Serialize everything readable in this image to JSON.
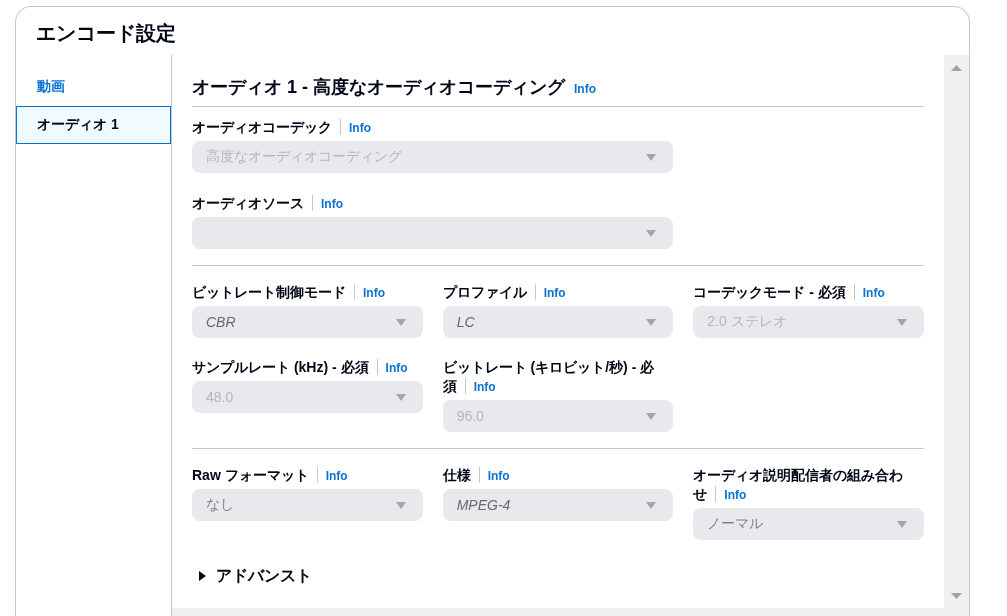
{
  "window": {
    "title": "エンコード設定"
  },
  "sidebar": {
    "items": [
      {
        "label": "動画",
        "selected": false
      },
      {
        "label": "オーディオ 1",
        "selected": true
      }
    ]
  },
  "panel": {
    "heading": "オーディオ 1 - 高度なオーディオコーディング",
    "heading_info": "Info",
    "sections": [
      {
        "kind": "stacked",
        "fields": [
          {
            "label": "オーディオコーデック",
            "info": "Info",
            "value": "高度なオーディオコーディング",
            "disabled": true
          },
          {
            "label": "オーディオソース",
            "info": "Info"
          }
        ]
      },
      {
        "kind": "grid",
        "fields": [
          {
            "label": "ビットレート制御モード",
            "info": "Info",
            "placeholder": "CBR"
          },
          {
            "label": "プロファイル",
            "info": "Info",
            "placeholder": "LC"
          },
          {
            "label": "コーデックモード - 必須",
            "info": "Info",
            "value": "2.0 ステレオ",
            "disabled": true
          },
          {
            "label": "サンプルレート (kHz) - 必須",
            "info": "Info",
            "value": "48.0",
            "disabled": true
          },
          {
            "label": "ビットレート (キロビット/秒) - 必須",
            "info": "Info",
            "value": "96.0",
            "disabled": true
          }
        ]
      },
      {
        "kind": "grid",
        "fields": [
          {
            "label": "Raw フォーマット",
            "info": "Info",
            "value": "なし",
            "disabled": false
          },
          {
            "label": "仕様",
            "info": "Info",
            "placeholder": "MPEG-4"
          },
          {
            "label": "オーディオ説明配信者の組み合わせ",
            "info": "Info",
            "value": "ノーマル",
            "disabled": false
          }
        ]
      }
    ]
  },
  "advanced": {
    "label": "アドバンスト",
    "expanded": false
  }
}
